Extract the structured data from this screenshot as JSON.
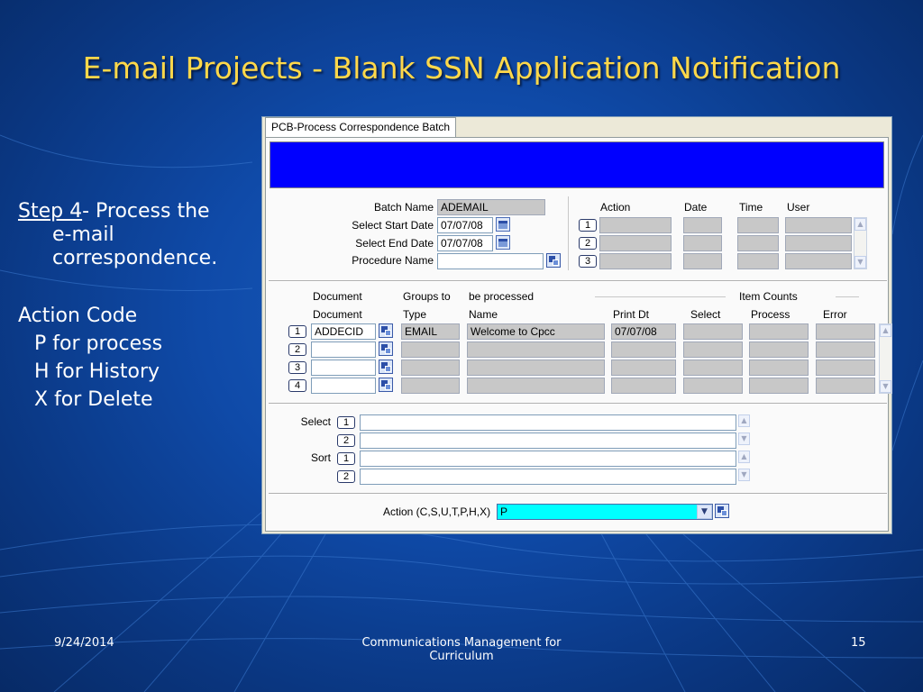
{
  "slide": {
    "title": "E-mail Projects - Blank SSN Application Notification",
    "step_label": "Step 4",
    "step_text": "- Process the",
    "step_text_line2": "e-mail",
    "step_text_line3": "correspondence.",
    "action_code_heading": "Action Code",
    "action_codes": [
      "P for process",
      "H for History",
      "X for Delete"
    ],
    "footer_date": "9/24/2014",
    "footer_center_line1": "Communications Management for",
    "footer_center_line2": "Curriculum",
    "footer_page": "15"
  },
  "window": {
    "tab_label": "PCB-Process Correspondence Batch",
    "batch": {
      "batch_name_label": "Batch Name",
      "batch_name_value": "ADEMAIL",
      "start_date_label": "Select Start Date",
      "start_date_value": "07/07/08",
      "end_date_label": "Select End Date",
      "end_date_value": "07/07/08",
      "procedure_name_label": "Procedure Name",
      "procedure_name_value": ""
    },
    "action_grid": {
      "headers": [
        "Action",
        "Date",
        "Time",
        "User"
      ],
      "rows": [
        "1",
        "2",
        "3"
      ]
    },
    "document_grid": {
      "header_row1": [
        "Document",
        "Groups to",
        "be processed",
        "Item Counts"
      ],
      "header_row2": [
        "Document",
        "Type",
        "Name",
        "Print Dt",
        "Select",
        "Process",
        "Error"
      ],
      "rows": [
        {
          "num": "1",
          "document": "ADDECID",
          "type": "EMAIL",
          "name": "Welcome to Cpcc",
          "print_dt": "07/07/08"
        },
        {
          "num": "2",
          "document": "",
          "type": "",
          "name": "",
          "print_dt": ""
        },
        {
          "num": "3",
          "document": "",
          "type": "",
          "name": "",
          "print_dt": ""
        },
        {
          "num": "4",
          "document": "",
          "type": "",
          "name": "",
          "print_dt": ""
        }
      ]
    },
    "select_sort": {
      "select_label": "Select",
      "sort_label": "Sort",
      "nums": [
        "1",
        "2",
        "1",
        "2"
      ]
    },
    "action": {
      "label": "Action (C,S,U,T,P,H,X)",
      "value": "P"
    }
  }
}
